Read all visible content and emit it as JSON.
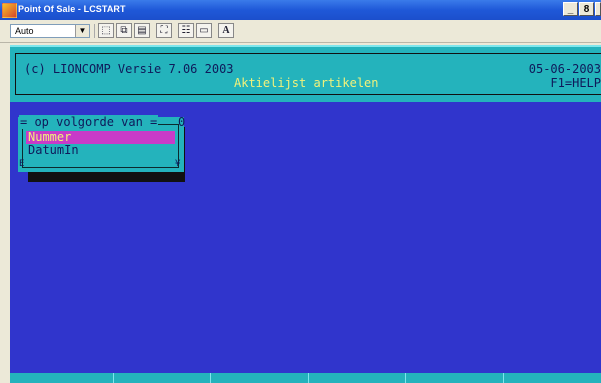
{
  "window": {
    "title": "Point Of Sale - LCSTART",
    "controls": [
      "_",
      "8",
      ""
    ]
  },
  "toolbar": {
    "font_select": "Auto",
    "font_button_label": "A"
  },
  "console": {
    "copyright": "(c) LIONCOMP Versie 7.06 2003",
    "subtitle": "Aktielijst artikelen",
    "date": "05-06-2003",
    "help": "F1=HELP"
  },
  "popup": {
    "title": "= op volgorde van =",
    "title_marker": "0",
    "corner_bl": "E",
    "corner_br": "¥",
    "items": [
      {
        "label": "Nummer",
        "selected": true
      },
      {
        "label": "DatumIn",
        "selected": false
      }
    ]
  },
  "colors": {
    "console_bg": "#3035CC",
    "header_bg": "#24B3BC",
    "subtitle_text": "#F2F27A",
    "selection": "#C83BC8"
  }
}
